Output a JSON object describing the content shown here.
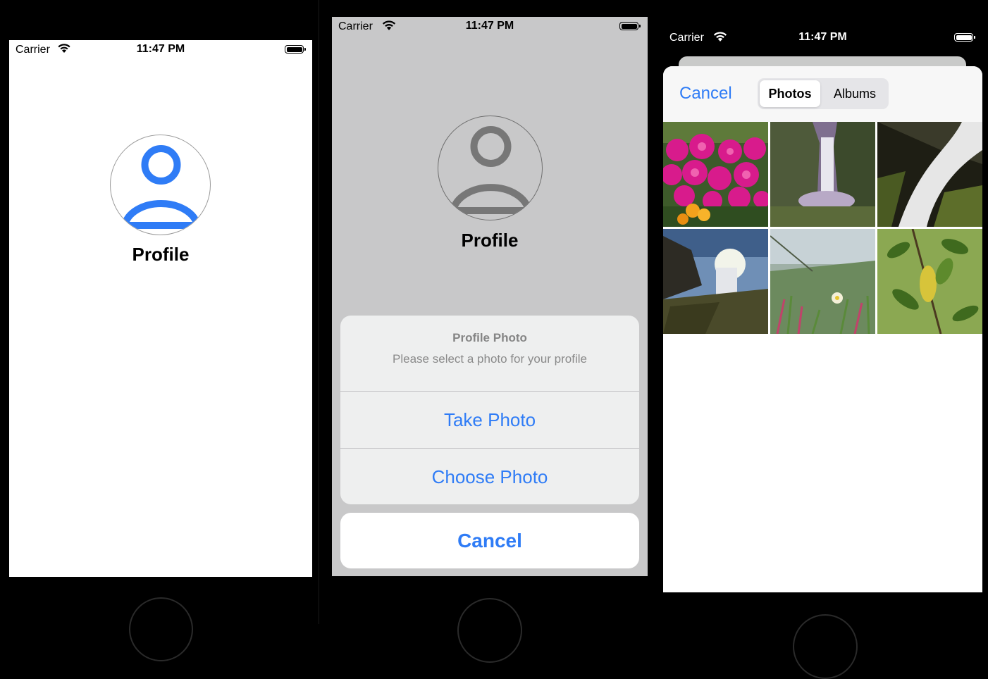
{
  "status_bar": {
    "carrier": "Carrier",
    "time": "11:47 PM"
  },
  "screen1": {
    "title": "Profile"
  },
  "screen2": {
    "title": "Profile",
    "action_sheet": {
      "title": "Profile Photo",
      "message": "Please select a photo for your profile",
      "options": [
        "Take Photo",
        "Choose Photo"
      ],
      "cancel": "Cancel"
    }
  },
  "screen3": {
    "cancel": "Cancel",
    "segments": [
      "Photos",
      "Albums"
    ],
    "selected_segment": "Photos"
  },
  "colors": {
    "accent": "#2f7cf6",
    "sheet_bg": "#eeefef",
    "dim_bg": "#c8c8c9"
  }
}
